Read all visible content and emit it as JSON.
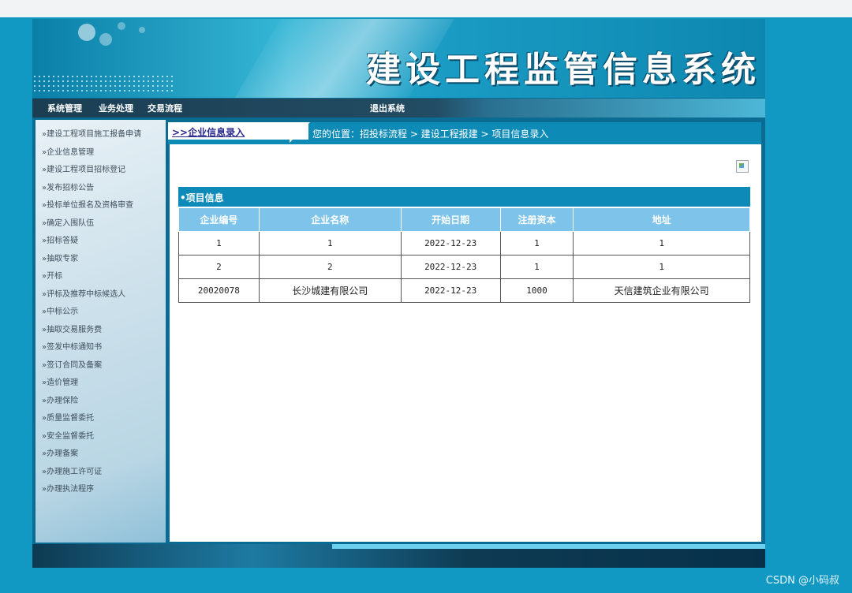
{
  "header": {
    "system_title": "建设工程监管信息系统"
  },
  "nav": {
    "items": [
      "系统管理",
      "业务处理",
      "交易流程"
    ],
    "logout": "退出系统"
  },
  "sidebar": {
    "items": [
      "»建设工程项目施工报备申请",
      "»企业信息管理",
      "»建设工程项目招标登记",
      "»发布招标公告",
      "»投标单位报名及资格审查",
      "»确定入围队伍",
      "»招标答疑",
      "»抽取专家",
      "»开标",
      "»评标及推荐中标候选人",
      "»中标公示",
      "»抽取交易服务费",
      "»签发中标通知书",
      "»签订合同及备案",
      "»造价管理",
      "»办理保险",
      "»质量监督委托",
      "»安全监督委托",
      "»办理备案",
      "»办理施工许可证",
      "»办理执法程序"
    ]
  },
  "breadcrumb": {
    "tab_label": ">>企业信息录入",
    "location": "您的位置：招投标流程 > 建设工程报建 > 项目信息录入"
  },
  "panel": {
    "title": "•项目信息",
    "columns": [
      "企业编号",
      "企业名称",
      "开始日期",
      "注册资本",
      "地址"
    ],
    "rows": [
      [
        "1",
        "1",
        "2022-12-23",
        "1",
        "1"
      ],
      [
        "2",
        "2",
        "2022-12-23",
        "1",
        "1"
      ],
      [
        "20020078",
        "长沙城建有限公司",
        "2022-12-23",
        "1000",
        "天信建筑企业有限公司"
      ]
    ]
  },
  "watermark": "CSDN @小码叔",
  "colors": {
    "page_bg": "#1199c4",
    "header_accent": "#0d8ab7",
    "table_header": "#7dc3ea"
  }
}
